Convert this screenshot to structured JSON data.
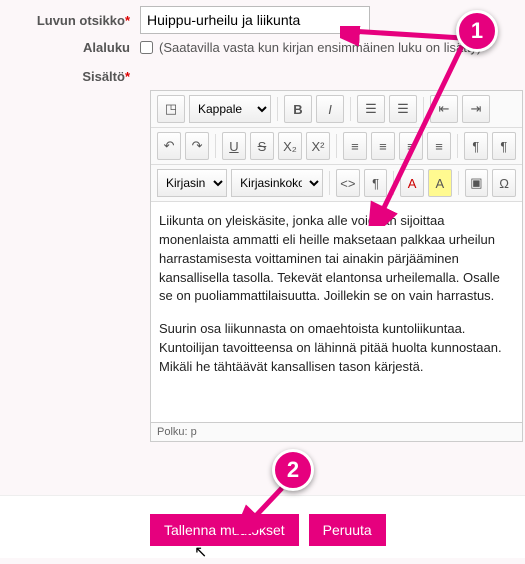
{
  "fields": {
    "title_label": "Luvun otsikko",
    "title_value": "Huippu-urheilu ja liikunta",
    "subchapter_label": "Alaluku",
    "subchapter_hint": "(Saatavilla vasta kun kirjan ensimmäinen luku on lisätty)",
    "content_label": "Sisältö"
  },
  "toolbar": {
    "source_icon": "◳",
    "format_select": "Kappale",
    "bold": "B",
    "italic": "I",
    "bullets": "≡•",
    "numbers": "≡1",
    "outdent": "⇤",
    "indent": "⇥",
    "undo": "↶",
    "redo": "↷",
    "underline": "U",
    "strike": "S",
    "sub": "X₂",
    "sup": "X²",
    "align_left": "≡",
    "align_center": "≡",
    "align_right": "≡",
    "align_just": "≡",
    "ltr": "¶→",
    "rtl": "←¶",
    "font_select": "Kirjasin",
    "size_select": "Kirjasinkoko",
    "code": "<>",
    "para": "¶",
    "fgcolor": "A",
    "bgcolor": "A",
    "image": "▣",
    "omega": "Ω"
  },
  "content": {
    "p1": "Liikunta on yleiskäsite, jonka alle voidaan sijoittaa monenlaista ammatti eli heille maksetaan palkkaa urheilun harrastamisesta voittaminen tai ainakin pärjääminen kansallisella tasolla. Tekevät elantonsa urheilemalla. Osalle se on puoliammattilaisuutta. Joillekin se on vain harrastus.",
    "p2": "Suurin osa liikunnasta on omaehtoista kuntoliikuntaa. Kuntoilijan tavoitteensa on lähinnä pitää huolta kunnostaan. Mikäli he tähtäävät kansallisen tason kärjestä."
  },
  "pathbar": "Polku: p",
  "buttons": {
    "save": "Tallenna muutokset",
    "cancel": "Peruuta"
  },
  "callouts": {
    "one": "1",
    "two": "2"
  }
}
